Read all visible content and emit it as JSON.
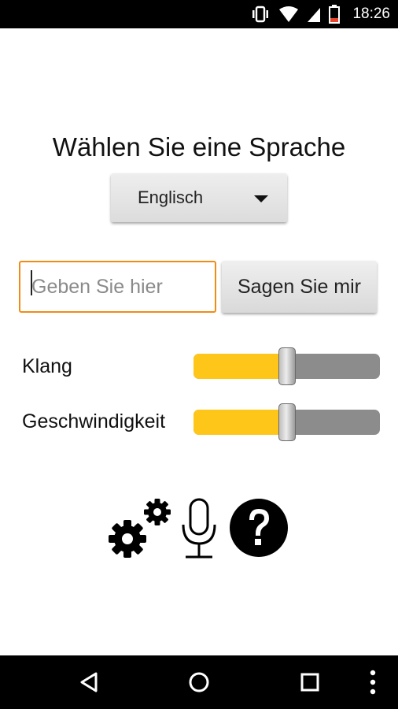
{
  "status_bar": {
    "time": "18:26",
    "icons": [
      "vibrate-icon",
      "wifi-icon",
      "cell-signal-icon",
      "battery-low-icon"
    ]
  },
  "main": {
    "title": "Wählen Sie eine Sprache",
    "language_select": {
      "selected": "Englisch"
    },
    "text_input": {
      "value": "",
      "placeholder": "Geben Sie hier"
    },
    "speak_button": "Sagen Sie mir",
    "sliders": [
      {
        "label": "Klang",
        "fraction": 0.5
      },
      {
        "label": "Geschwindigkeit",
        "fraction": 0.5
      }
    ],
    "actions": [
      "settings-gears-icon",
      "microphone-icon",
      "help-icon"
    ],
    "accent_color": "#f08c14",
    "slider_fill_color": "#ffc61a"
  },
  "nav_bar": {
    "buttons": [
      "back-icon",
      "home-icon",
      "recents-icon",
      "overflow-menu-icon"
    ]
  }
}
